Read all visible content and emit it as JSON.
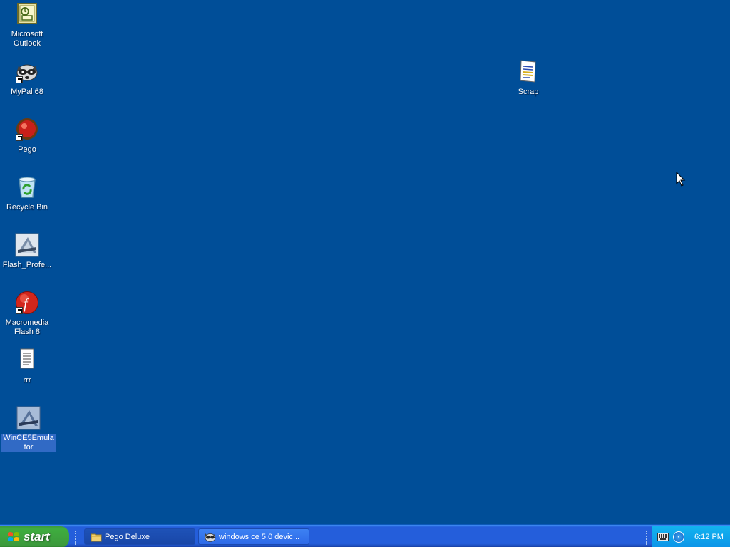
{
  "desktop": {
    "background": "#004e98",
    "icons": [
      {
        "label": "Microsoft Outlook",
        "icon": "outlook-icon"
      },
      {
        "label": "MyPal 68",
        "icon": "raccoon-icon"
      },
      {
        "label": "Pego",
        "icon": "pego-ball-icon"
      },
      {
        "label": "Recycle Bin",
        "icon": "recycle-bin-icon"
      },
      {
        "label": "Flash_Profe...",
        "icon": "flash-professional-icon"
      },
      {
        "label": "Macromedia Flash 8",
        "icon": "macromedia-flash-icon"
      },
      {
        "label": "rrr",
        "icon": "text-document-icon"
      },
      {
        "label": "WinCE5Emulator",
        "icon": "emulator-icon",
        "selected": true
      },
      {
        "label": "Scrap",
        "icon": "scrap-document-icon"
      }
    ]
  },
  "taskbar": {
    "start_label": "start",
    "tasks": [
      {
        "label": "Pego Deluxe",
        "icon": "folder-icon"
      },
      {
        "label": "windows ce 5.0 devic...",
        "icon": "raccoon-icon"
      }
    ],
    "clock": "6:12 PM"
  }
}
